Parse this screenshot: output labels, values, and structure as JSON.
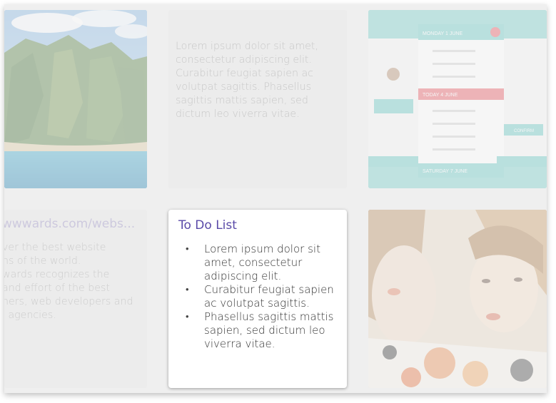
{
  "tiles": {
    "landscape": {
      "icon": "landscape-photo"
    },
    "lorem_card": {
      "text": "Lorem ipsum dolor sit amet, consectetur adipiscing elit. Curabitur feugiat sapien ac volutpat sagittis. Phasellus sagittis mattis sapien, sed dictum leo viverra vitae."
    },
    "app_screenshot": {
      "header": "MONDAY 1 JUNE",
      "section": "TODAY 4 JUNE",
      "footer": "SATURDAY 7 JUNE",
      "button": "CONFIRM"
    },
    "awwwards": {
      "url": "wwwards.com/webs...",
      "lines": [
        "ver the best website",
        "ns of the world.",
        "wards recognizes the",
        " and effort of the best",
        "ners, web developers and",
        "l agencies."
      ]
    },
    "todo": {
      "title": "To Do List",
      "items": [
        "Lorem ipsum dolor sit amet, consectetur adipiscing elit.",
        "Curabitur feugiat sapien ac volutpat sagittis.",
        "Phasellus sagittis mattis sapien, sed dictum leo viverra vitae."
      ],
      "bullet": "•"
    },
    "portrait": {
      "icon": "portrait-photo"
    }
  },
  "colors": {
    "accent": "#5a4aa8",
    "app_teal": "#5fc4c0",
    "app_red": "#e8505b"
  }
}
